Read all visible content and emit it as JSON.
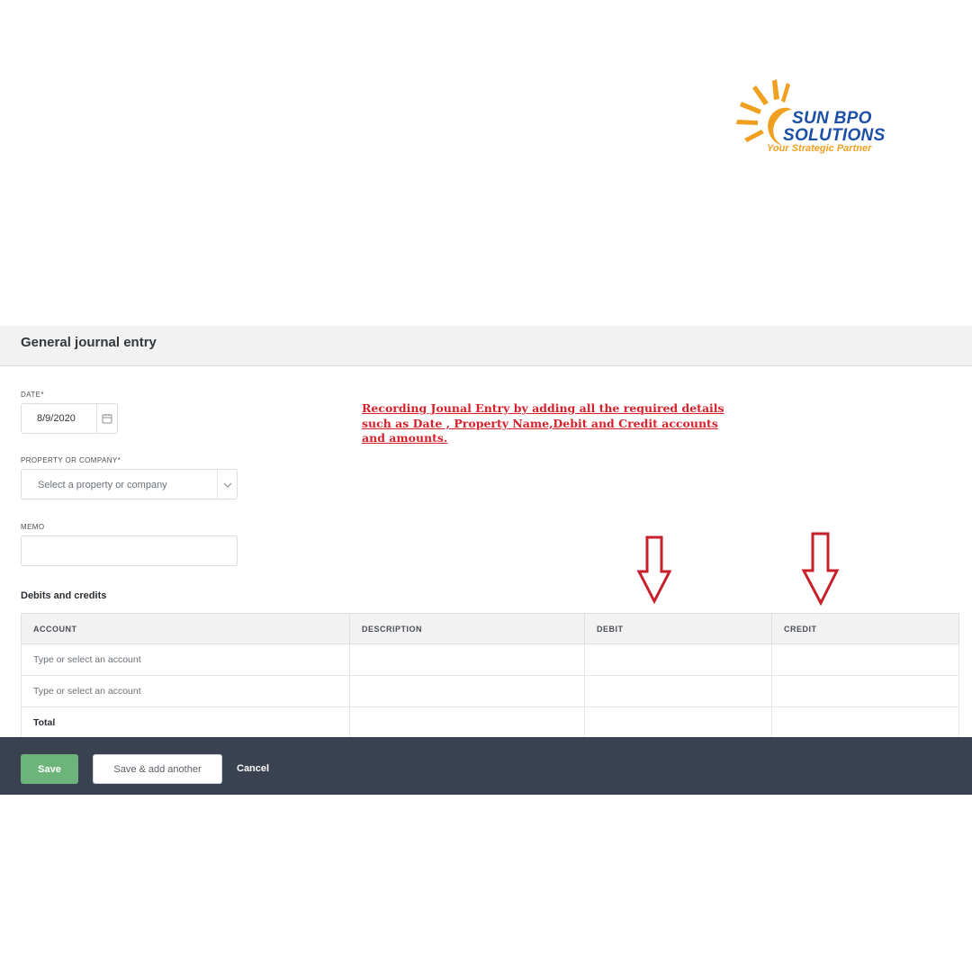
{
  "logo": {
    "line1": "SUN BPO",
    "line2": "SOLUTIONS",
    "tagline": "Your Strategic Partner",
    "colors": {
      "sun": "#f0a020",
      "text": "#1d4fa8"
    }
  },
  "page": {
    "title": "General journal entry"
  },
  "form": {
    "date": {
      "label": "DATE",
      "required_mark": "*",
      "value": "8/9/2020"
    },
    "property": {
      "label": "PROPERTY OR COMPANY",
      "required_mark": "*",
      "placeholder": "Select a property or company"
    },
    "memo": {
      "label": "MEMO",
      "value": ""
    }
  },
  "annotation": {
    "text": "Recording Jounal Entry by adding  all the required details such as Date , Property Name,Debit and Credit accounts and amounts.",
    "color": "#d6202b"
  },
  "debits_credits": {
    "title": "Debits and credits",
    "columns": [
      "ACCOUNT",
      "DESCRIPTION",
      "DEBIT",
      "CREDIT"
    ],
    "rows": [
      {
        "account": "Type or select an account",
        "description": "",
        "debit": "",
        "credit": ""
      },
      {
        "account": "Type or select an account",
        "description": "",
        "debit": "",
        "credit": ""
      }
    ],
    "total_label": "Total"
  },
  "footer": {
    "save_label": "Save",
    "save_add_label": "Save & add another",
    "cancel_label": "Cancel",
    "colors": {
      "bar": "#3a4150",
      "save": "#6db47b"
    }
  }
}
